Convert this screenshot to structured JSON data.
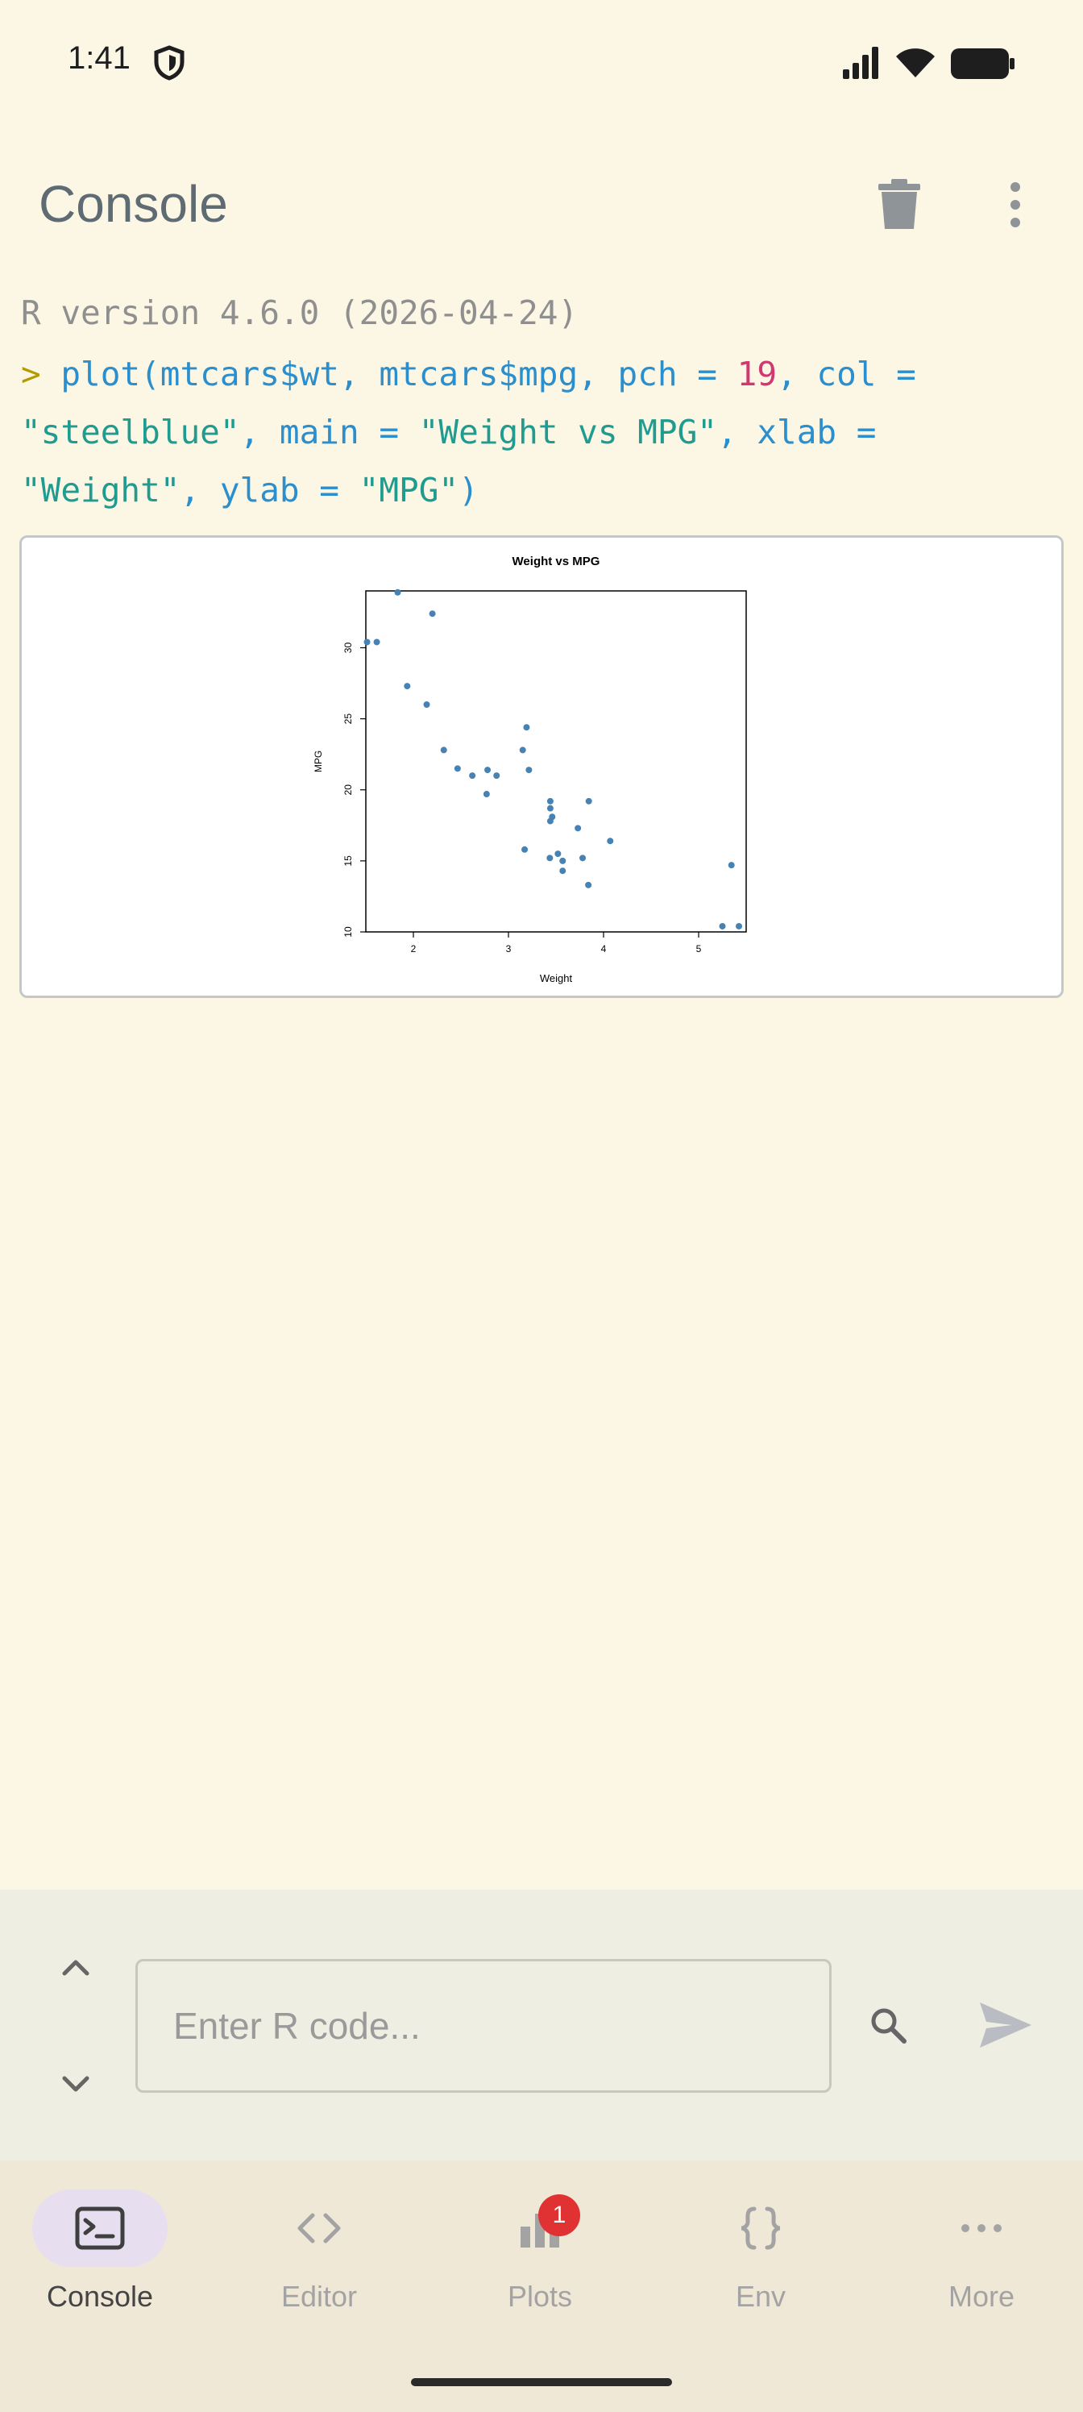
{
  "status_bar": {
    "time": "1:41"
  },
  "header": {
    "title": "Console"
  },
  "console": {
    "version_line": "R version 4.6.0 (2026-04-24)",
    "prompt": ">",
    "command_line_1": {
      "a": "plot(mtcars$wt, mtcars$mpg, pch = ",
      "num": "19",
      "b": ", col ="
    },
    "command_line_2": {
      "str1": "\"steelblue\"",
      "mid": ", main = ",
      "str2": "\"Weight vs MPG\"",
      "end": ", xlab ="
    },
    "command_line_3": {
      "str1": "\"Weight\"",
      "mid": ", ylab = ",
      "str2": "\"MPG\"",
      "end": ")"
    }
  },
  "chart_data": {
    "type": "scatter",
    "title": "Weight vs MPG",
    "xlabel": "Weight",
    "ylabel": "MPG",
    "xlim": [
      1.5,
      5.5
    ],
    "ylim": [
      10,
      34
    ],
    "xticks": [
      "2",
      "3",
      "4",
      "5"
    ],
    "yticks": [
      "10",
      "15",
      "20",
      "25",
      "30"
    ],
    "point_color": "#4682b4",
    "x": [
      2.62,
      2.875,
      2.32,
      3.215,
      3.44,
      3.46,
      3.57,
      3.19,
      3.15,
      3.44,
      3.44,
      4.07,
      3.73,
      3.78,
      5.25,
      5.424,
      5.345,
      2.2,
      1.615,
      1.835,
      2.465,
      3.52,
      3.435,
      3.84,
      3.845,
      1.935,
      2.14,
      1.513,
      3.17,
      2.77,
      3.57,
      2.78
    ],
    "y": [
      21.0,
      21.0,
      22.8,
      21.4,
      18.7,
      18.1,
      14.3,
      24.4,
      22.8,
      19.2,
      17.8,
      16.4,
      17.3,
      15.2,
      10.4,
      10.4,
      14.7,
      32.4,
      30.4,
      33.9,
      21.5,
      15.5,
      15.2,
      13.3,
      19.2,
      27.3,
      26.0,
      30.4,
      15.8,
      19.7,
      15.0,
      21.4
    ]
  },
  "input": {
    "placeholder": "Enter R code..."
  },
  "nav": {
    "items": [
      {
        "label": "Console"
      },
      {
        "label": "Editor"
      },
      {
        "label": "Plots"
      },
      {
        "label": "Env"
      },
      {
        "label": "More"
      }
    ],
    "plots_badge": "1"
  }
}
